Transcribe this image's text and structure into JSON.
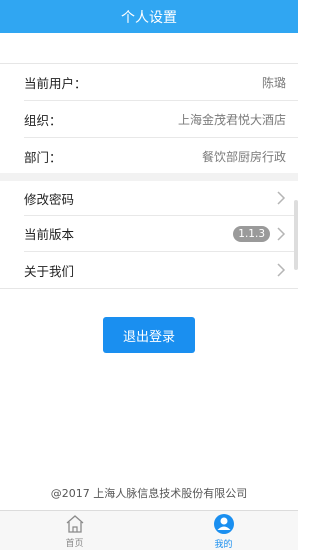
{
  "header": {
    "title": "个人设置"
  },
  "profile": {
    "user_label": "当前用户：",
    "user_value": "陈璐",
    "org_label": "组织：",
    "org_value": "上海金茂君悦大酒店",
    "dept_label": "部门：",
    "dept_value": "餐饮部厨房行政"
  },
  "menu": {
    "change_password": "修改密码",
    "version_label": "当前版本",
    "version_value": "1.1.3",
    "about_us": "关于我们",
    "chevron_icon": "chevron-right-icon"
  },
  "logout": {
    "label": "退出登录"
  },
  "footer": {
    "copyright": "@2017  上海人脉信息技术股份有限公司"
  },
  "tabbar": {
    "items": [
      {
        "label": "首页",
        "icon": "home-icon"
      },
      {
        "label": "我的",
        "icon": "profile-icon"
      }
    ],
    "active_color": "#1a8ff0"
  },
  "colors": {
    "header": "#30a6f2",
    "button": "#1a8ff0"
  }
}
